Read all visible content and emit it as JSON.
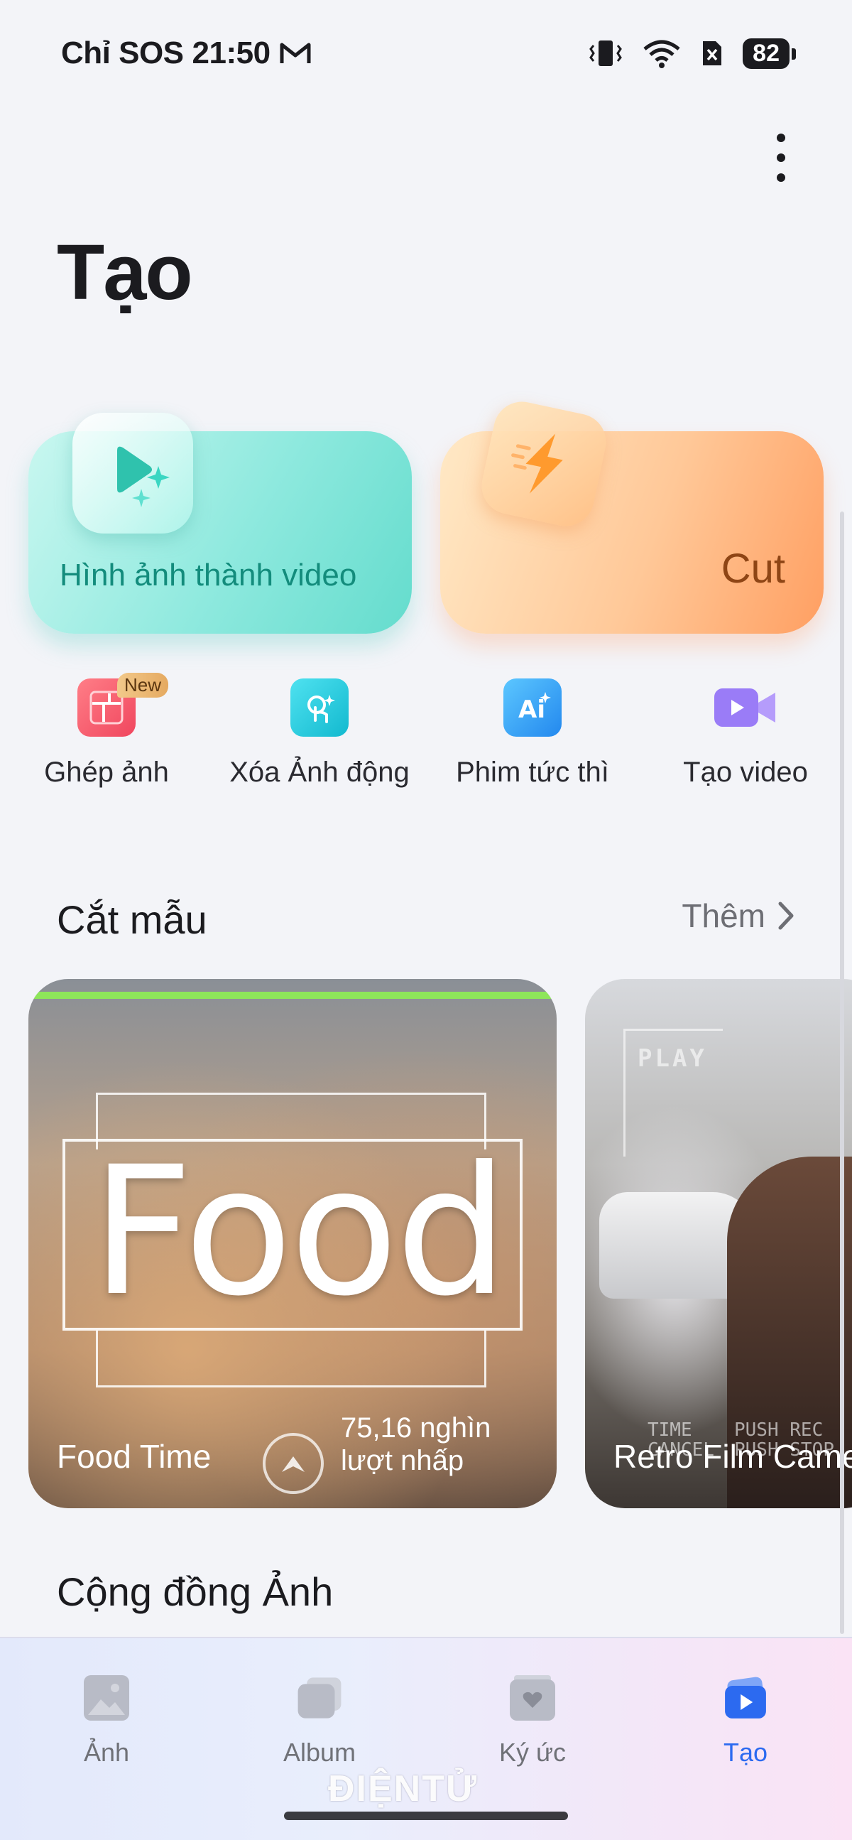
{
  "status_bar": {
    "carrier": "Chỉ SOS",
    "time": "21:50",
    "battery": "82",
    "icons": [
      "gmail-icon",
      "vibrate-icon",
      "wifi-icon",
      "sim-off-icon",
      "battery-icon"
    ]
  },
  "header": {
    "title": "Tạo",
    "menu_icon": "more-vertical-icon"
  },
  "feature_cards": [
    {
      "label": "Hình ảnh thành video",
      "icon": "play-sparkle-icon",
      "accent": "#138c7c"
    },
    {
      "label": "Cut",
      "icon": "lightning-icon",
      "accent": "#8e4515"
    }
  ],
  "tools": [
    {
      "label": "Ghép ảnh",
      "icon": "collage-icon",
      "badge": "New",
      "color": "#f0586a"
    },
    {
      "label": "Xóa Ảnh động",
      "icon": "magic-eraser-icon",
      "color": "#19c6d8"
    },
    {
      "label": "Phim tức thì",
      "icon": "ai-movie-icon",
      "color": "#2e9cf2"
    },
    {
      "label": "Tạo video",
      "icon": "video-camera-icon",
      "color": "#8f6cf5"
    }
  ],
  "templates_section": {
    "title": "Cắt mẫu",
    "more_label": "Thêm",
    "items": [
      {
        "name": "Food Time",
        "overlay_text": "Food",
        "views": "75,16 nghìn",
        "views_suffix": "lượt nhấp"
      },
      {
        "name": "Retro Film Camera",
        "overlay_text": "PLAY",
        "overlay_labels": [
          "TIME",
          "PUSH REC",
          "CANCEL",
          "PUSH STOP"
        ]
      }
    ]
  },
  "community_section": {
    "title": "Cộng đồng Ảnh"
  },
  "bottom_nav": {
    "items": [
      {
        "label": "Ảnh",
        "icon": "photo-icon",
        "active": false
      },
      {
        "label": "Album",
        "icon": "album-icon",
        "active": false
      },
      {
        "label": "Ký ức",
        "icon": "memories-icon",
        "active": false
      },
      {
        "label": "Tạo",
        "icon": "create-icon",
        "active": true
      }
    ],
    "active_color": "#2c6af0"
  },
  "watermark": "ĐIỆNTỬ"
}
